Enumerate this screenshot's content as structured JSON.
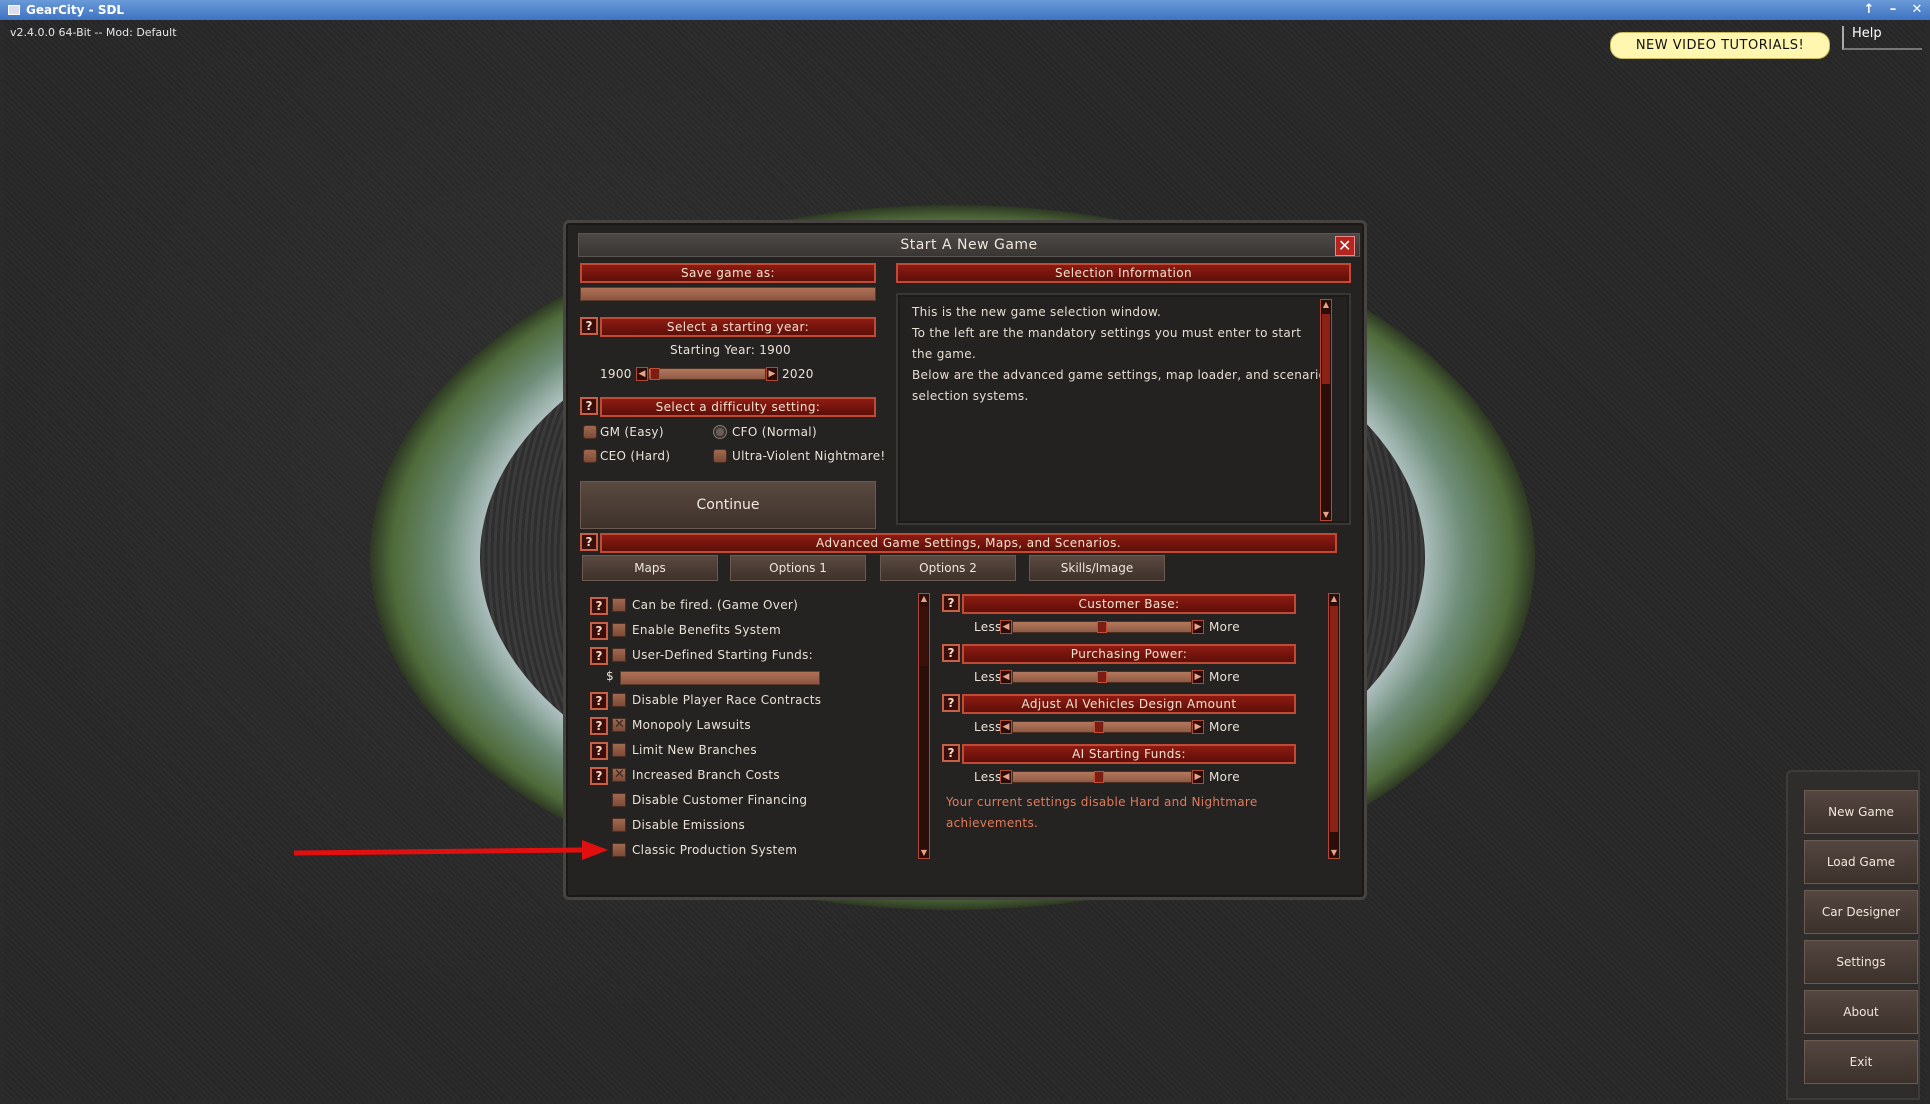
{
  "window": {
    "title": "GearCity - SDL",
    "version": "v2.4.0.0  64-Bit  --  Mod:  Default",
    "controls": [
      "↑",
      "–",
      "✕"
    ]
  },
  "top_right": {
    "tutorials": "NEW  VIDEO  TUTORIALS!",
    "help": "Help"
  },
  "dialog": {
    "title": "Start  A  New  Game",
    "save_header": "Save  game  as:",
    "save_value": "",
    "year_header": "Select  a  starting  year:",
    "starting_year_label": "Starting  Year:  1900",
    "year_min": "1900",
    "year_max": "2020",
    "year_fraction": 0.0,
    "difficulty_header": "Select  a  difficulty  setting:",
    "difficulties": [
      {
        "label": "GM  (Easy)",
        "selected": false
      },
      {
        "label": "CFO  (Normal)",
        "selected": true
      },
      {
        "label": "CEO  (Hard)",
        "selected": false
      },
      {
        "label": "Ultra-Violent  Nightmare!",
        "selected": false
      }
    ],
    "continue": "Continue",
    "info_header": "Selection  Information",
    "info_lines": [
      "This  is  the  new  game  selection  window.",
      "To  the  left  are  the  mandatory  settings  you  must  enter  to  start",
      "the  game.",
      "Below  are  the  advanced  game  settings,  map  loader,  and  scenario",
      " selection  systems."
    ],
    "advanced_header": "Advanced  Game  Settings,  Maps,  and  Scenarios.",
    "tabs": [
      "Maps",
      "Options  1",
      "Options  2",
      "Skills/Image"
    ],
    "options": [
      {
        "label": "Can  be  fired.  (Game  Over)",
        "help": true,
        "checked": false
      },
      {
        "label": "Enable  Benefits  System",
        "help": true,
        "checked": false
      },
      {
        "label": "User-Defined  Starting  Funds:",
        "help": true,
        "checked": false
      },
      {
        "label": "Disable  Player  Race  Contracts",
        "help": true,
        "checked": false
      },
      {
        "label": "Monopoly  Lawsuits",
        "help": true,
        "checked": true
      },
      {
        "label": "Limit  New  Branches",
        "help": true,
        "checked": false
      },
      {
        "label": "Increased  Branch  Costs",
        "help": true,
        "checked": true
      },
      {
        "label": "Disable  Customer  Financing",
        "help": false,
        "checked": false
      },
      {
        "label": "Disable  Emissions",
        "help": false,
        "checked": false
      },
      {
        "label": "Classic  Production  System",
        "help": false,
        "checked": false
      }
    ],
    "funds_prefix": "$",
    "sliders": [
      {
        "header": "Customer  Base:",
        "less": "Less",
        "more": "More",
        "level": 0.5
      },
      {
        "header": "Purchasing  Power:",
        "less": "Less",
        "more": "More",
        "level": 0.5
      },
      {
        "header": "Adjust  AI  Vehicles  Design  Amount",
        "less": "Less",
        "more": "More",
        "level": 0.48
      },
      {
        "header": "AI  Starting  Funds:",
        "less": "Less",
        "more": "More",
        "level": 0.48
      }
    ],
    "warning_lines": [
      "Your  current  settings  disable  Hard  and  Nightmare",
      "achievements."
    ]
  },
  "side_menu": [
    "New  Game",
    "Load  Game",
    "Car  Designer",
    "Settings",
    "About",
    "Exit"
  ],
  "colors": {
    "accent_red": "#8d1b12",
    "arrow": "#e01010",
    "tutorial_bg": "#fff7b0"
  }
}
